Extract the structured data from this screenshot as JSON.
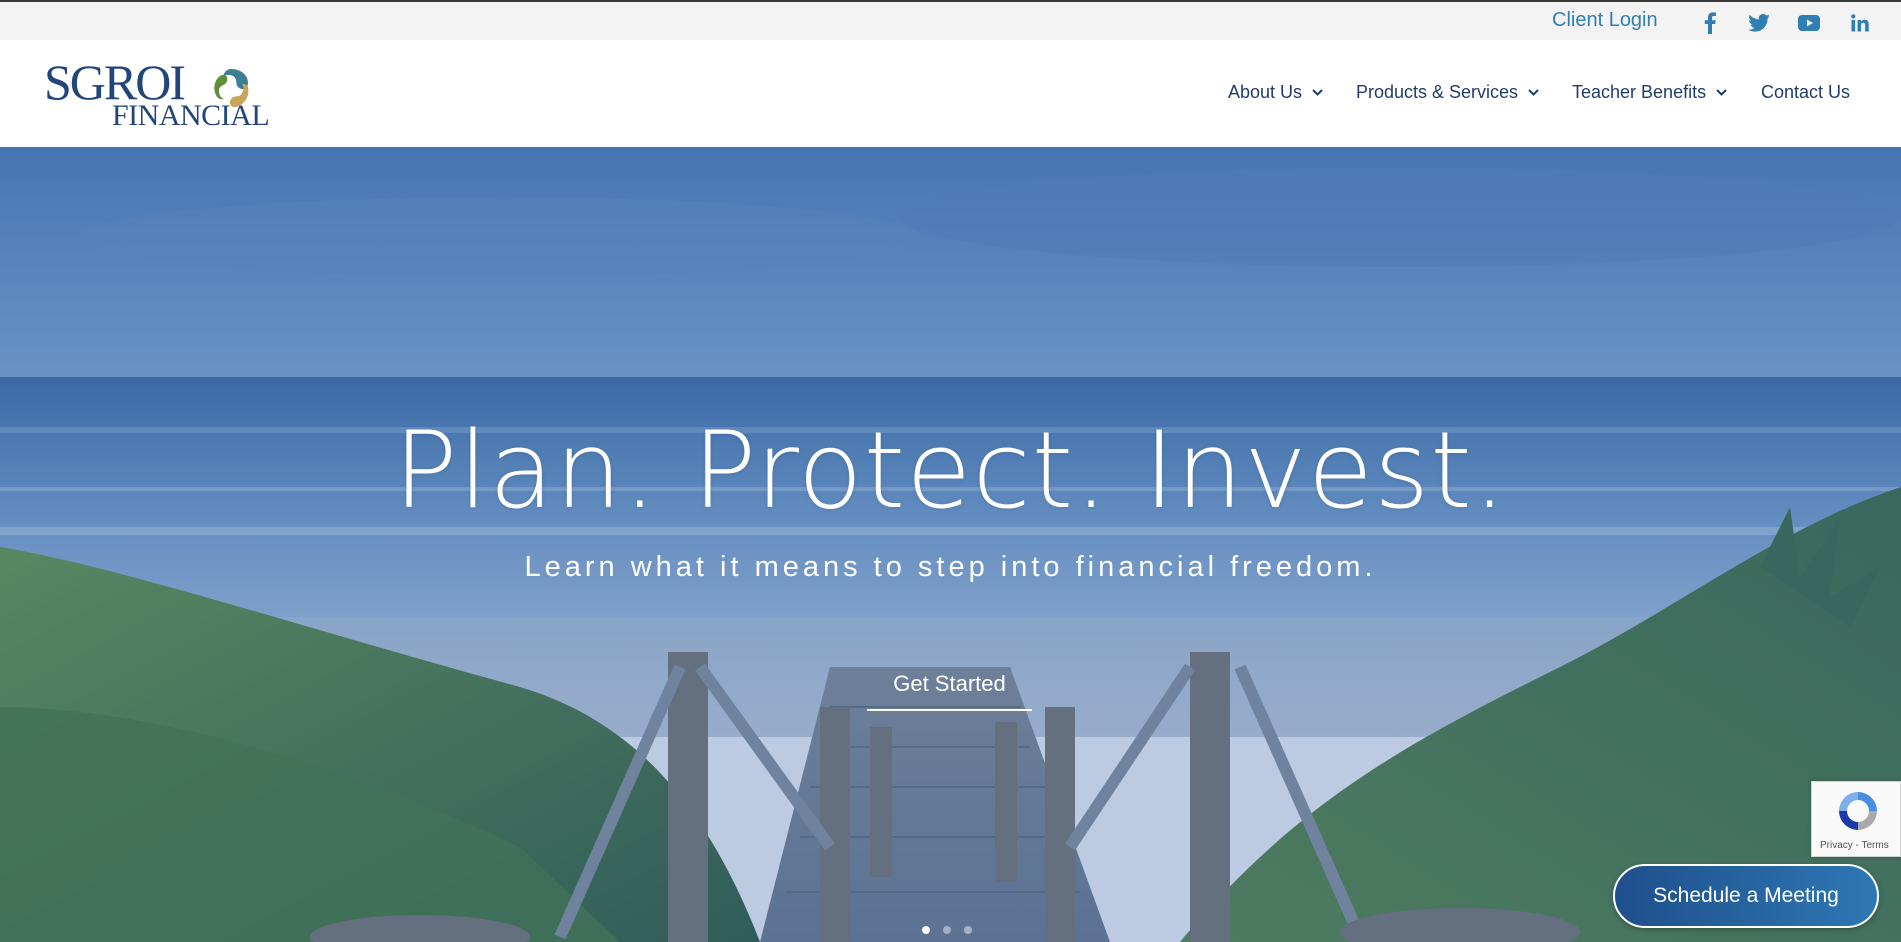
{
  "topbar": {
    "client_login": "Client Login",
    "social_icons": [
      "facebook-icon",
      "twitter-icon",
      "youtube-icon",
      "linkedin-icon"
    ],
    "accent_color": "#2f7fb4"
  },
  "logo": {
    "line1": "SGROI",
    "line2": "FINANCIAL",
    "colors": {
      "navy": "#22457a",
      "gold": "#c9a55a",
      "teal": "#3c7f95",
      "green": "#5e8f3c"
    }
  },
  "nav": {
    "items": [
      {
        "label": "About Us",
        "has_dropdown": true
      },
      {
        "label": "Products & Services",
        "has_dropdown": true
      },
      {
        "label": "Teacher Benefits",
        "has_dropdown": true
      },
      {
        "label": "Contact Us",
        "has_dropdown": false
      }
    ],
    "color": "#1f3d6b"
  },
  "hero": {
    "title": "Plan. Protect. Invest.",
    "subtitle": "Learn what it means to step into financial freedom.",
    "cta": "Get Started",
    "slides_count": 3,
    "active_slide": 1
  },
  "recaptcha": {
    "text": "Privacy - Terms"
  },
  "schedule_button": {
    "label": "Schedule a Meeting"
  }
}
